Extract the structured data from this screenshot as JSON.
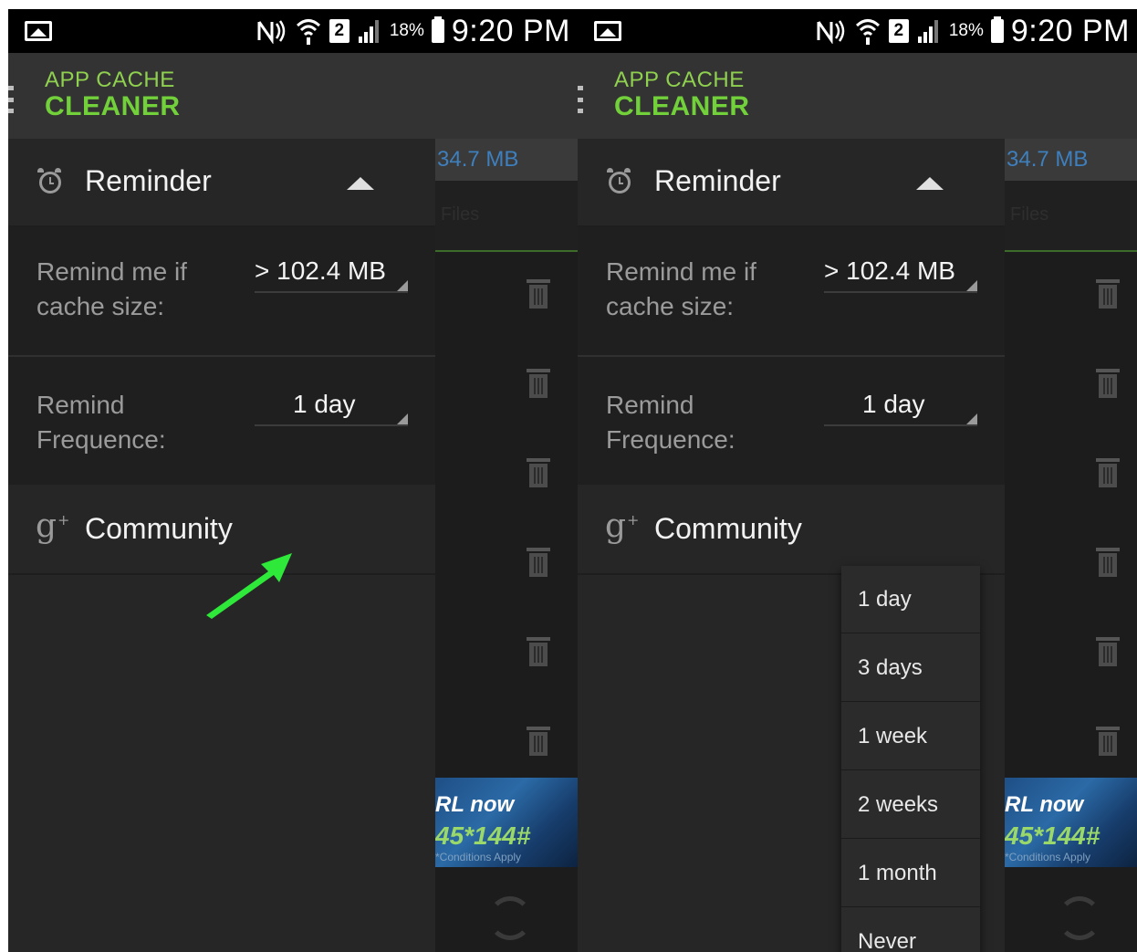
{
  "status_bar": {
    "battery_percent": "18%",
    "time": "9:20 PM",
    "sim_slot": "2"
  },
  "app": {
    "title_line1": "APP CACHE",
    "title_line2": "CLEANER"
  },
  "background": {
    "cache_size": "34.7 MB",
    "tab_label": "l Files",
    "ad_line1": "RL now",
    "ad_line2": "45*144#",
    "ad_line3": "*Conditions Apply"
  },
  "drawer": {
    "section_title": "Reminder",
    "remind_size_label": "Remind me if cache size:",
    "remind_size_value": "> 102.4 MB",
    "remind_freq_label": "Remind Frequence:",
    "remind_freq_value": "1 day",
    "community_label": "Community"
  },
  "frequency_options": [
    "1 day",
    "3 days",
    "1 week",
    "2 weeks",
    "1 month",
    "Never"
  ],
  "colors": {
    "accent_green": "#72d13a",
    "arrow_green": "#2ee83a",
    "size_blue": "#3e7fbd"
  },
  "icons": {
    "reminder": "alarm-clock-icon",
    "community": "google-plus-icon",
    "collapse": "caret-up-icon",
    "delete": "trash-icon",
    "refresh": "refresh-icon"
  }
}
